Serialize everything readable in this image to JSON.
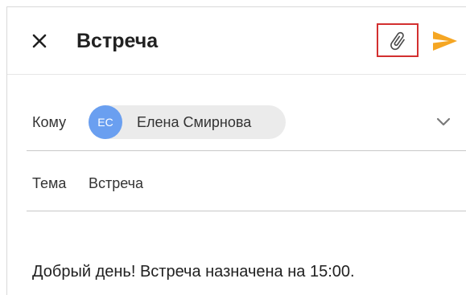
{
  "header": {
    "title": "Встреча",
    "icons": {
      "close": "close-icon",
      "attach": "paperclip-icon",
      "send": "send-icon"
    },
    "colors": {
      "send": "#f5a623",
      "attach_highlight": "#d32f2f"
    }
  },
  "recipient": {
    "label": "Кому",
    "chip": {
      "initials": "ЕС",
      "name": "Елена Смирнова",
      "avatar_color": "#6a9ff0"
    },
    "expand_icon": "chevron-down-icon"
  },
  "subject": {
    "label": "Тема",
    "value": "Встреча"
  },
  "body": {
    "text": "Добрый день! Встреча назначена на 15:00."
  }
}
